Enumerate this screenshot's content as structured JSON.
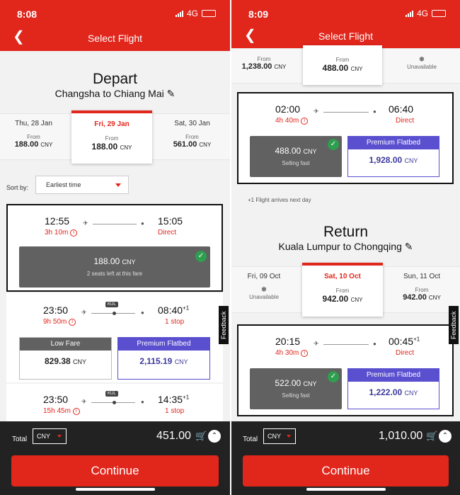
{
  "left": {
    "status": {
      "time": "8:08",
      "network": "4G"
    },
    "header": {
      "title": "Select Flight"
    },
    "heading": "Depart",
    "route": "Changsha to Chiang Mai",
    "dates": [
      {
        "label": "Thu, 28 Jan",
        "from": "From",
        "price": "188.00",
        "cur": "CNY"
      },
      {
        "label": "Fri, 29 Jan",
        "from": "From",
        "price": "188.00",
        "cur": "CNY",
        "selected": true
      },
      {
        "label": "Sat, 30 Jan",
        "from": "From",
        "price": "561.00",
        "cur": "CNY"
      }
    ],
    "sort": {
      "label": "Sort by:",
      "value": "Earliest time"
    },
    "flight1": {
      "dep": "12:55",
      "arr": "15:05",
      "dur": "3h 10m",
      "stops": "Direct",
      "fare_amount": "188.00",
      "fare_cur": "CNY",
      "fare_note": "2 seats left at this fare"
    },
    "flight2": {
      "dep": "23:50",
      "arr": "08:40",
      "arr_sup": "+1",
      "dur": "9h 50m",
      "stops": "1 stop",
      "via": "KUL",
      "low_label": "Low Fare",
      "low_amount": "829.38",
      "prem_label": "Premium Flatbed",
      "prem_amount": "2,115.19",
      "cur": "CNY"
    },
    "flight3": {
      "dep": "23:50",
      "arr": "14:35",
      "arr_sup": "+1",
      "dur": "15h 45m",
      "stops": "1 stop",
      "via": "KUL"
    },
    "feedback": "Feedback",
    "footer": {
      "total_label": "Total",
      "currency": "CNY",
      "total": "451.00",
      "continue": "Continue"
    }
  },
  "right": {
    "status": {
      "time": "8:09",
      "network": "4G"
    },
    "header": {
      "title": "Select Flight"
    },
    "top_dates": [
      {
        "from": "From",
        "price": "1,238.00",
        "cur": "CNY"
      },
      {
        "from": "From",
        "price": "488.00",
        "cur": "CNY",
        "selected": true
      },
      {
        "label": "Unavailable"
      }
    ],
    "flight_a": {
      "dep": "02:00",
      "arr": "06:40",
      "dur": "4h 40m",
      "stops": "Direct",
      "fare_amount": "488.00",
      "fare_cur": "CNY",
      "fare_note": "Selling fast",
      "prem_label": "Premium Flatbed",
      "prem_amount": "1,928.00",
      "cur": "CNY"
    },
    "next_day_note": "+1 Flight arrives next day",
    "heading": "Return",
    "route": "Kuala Lumpur to Chongqing",
    "dates": [
      {
        "label": "Fri, 09 Oct",
        "unavailable": "Unavailable"
      },
      {
        "label": "Sat, 10 Oct",
        "from": "From",
        "price": "942.00",
        "cur": "CNY",
        "selected": true
      },
      {
        "label": "Sun, 11 Oct",
        "from": "From",
        "price": "942.00",
        "cur": "CNY"
      }
    ],
    "flight_b": {
      "dep": "20:15",
      "arr": "00:45",
      "arr_sup": "+1",
      "dur": "4h 30m",
      "stops": "Direct",
      "fare_amount": "522.00",
      "fare_cur": "CNY",
      "fare_note": "Selling fast",
      "prem_label": "Premium Flatbed",
      "prem_amount": "1,222.00",
      "cur": "CNY"
    },
    "feedback": "Feedback",
    "footer": {
      "total_label": "Total",
      "currency": "CNY",
      "total": "1,010.00",
      "continue": "Continue"
    }
  },
  "colors": {
    "brand": "#e1261c",
    "premium": "#5a4fcf",
    "selected_fare": "#616161",
    "check": "#2e9e4f"
  }
}
